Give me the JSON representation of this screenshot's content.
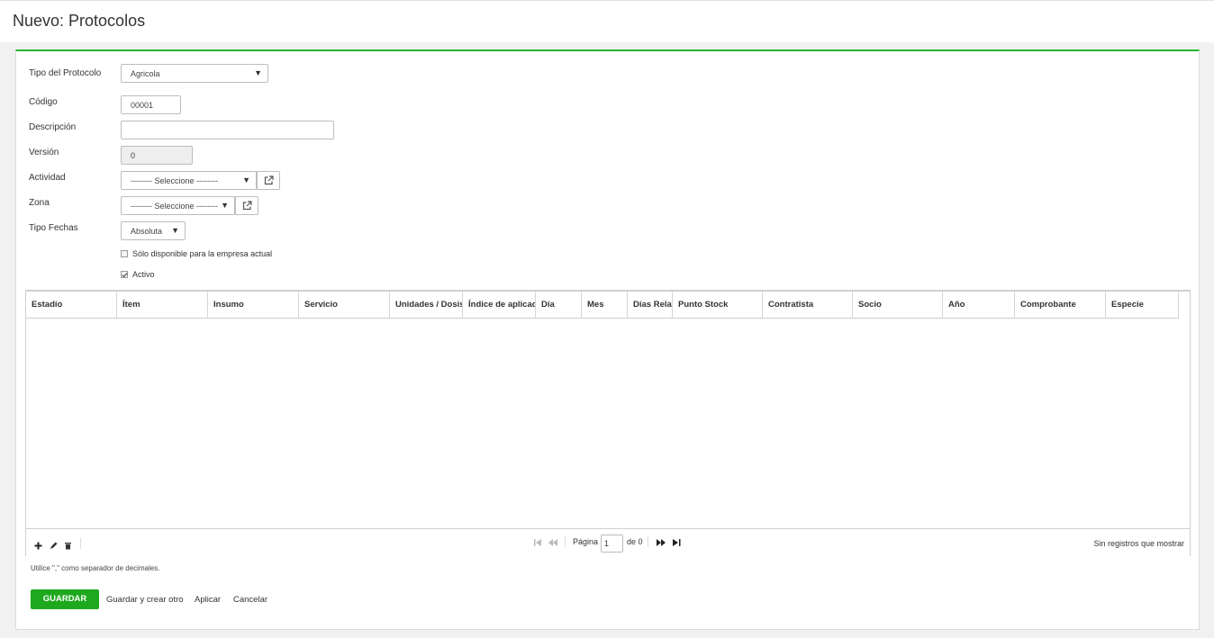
{
  "header": {
    "title": "Nuevo: Protocolos"
  },
  "form": {
    "tipo_protocolo": {
      "label": "Tipo del Protocolo",
      "value": "Agricola"
    },
    "codigo": {
      "label": "Código",
      "value": "00001"
    },
    "descripcion": {
      "label": "Descripción",
      "value": ""
    },
    "version": {
      "label": "Versión",
      "value": "0"
    },
    "actividad": {
      "label": "Actividad",
      "value": "-------- Seleccione --------"
    },
    "zona": {
      "label": "Zona",
      "value": "-------- Seleccione --------"
    },
    "tipo_fechas": {
      "label": "Tipo Fechas",
      "value": "Absoluta"
    },
    "solo_disponible": {
      "label": "Sólo disponible para la empresa actual",
      "checked": false
    },
    "activo": {
      "label": "Activo",
      "checked": true
    }
  },
  "grid": {
    "columns": [
      "Estadío",
      "Ítem",
      "Insumo",
      "Servicio",
      "Unidades / Dosis",
      "Índice de aplicaci",
      "Día",
      "Mes",
      "Días Relat",
      "Punto Stock",
      "Contratista",
      "Socio",
      "Año",
      "Comprobante",
      "Especie"
    ],
    "rows": [],
    "pager": {
      "page_label": "Página",
      "page_value": "1",
      "of_label": "de 0"
    },
    "no_records": "Sin registros que mostrar",
    "icons": [
      "add-icon",
      "edit-icon",
      "delete-icon",
      "first-page-icon",
      "prev-page-icon",
      "next-page-icon",
      "last-page-icon"
    ]
  },
  "hint": "Utilice \",\" como separador de decimales.",
  "actions": {
    "save": "GUARDAR",
    "save_and_new": "Guardar y crear otro",
    "apply": "Aplicar",
    "cancel": "Cancelar"
  },
  "colors": {
    "accent": "#22b631",
    "save_button": "#1ea81e"
  }
}
